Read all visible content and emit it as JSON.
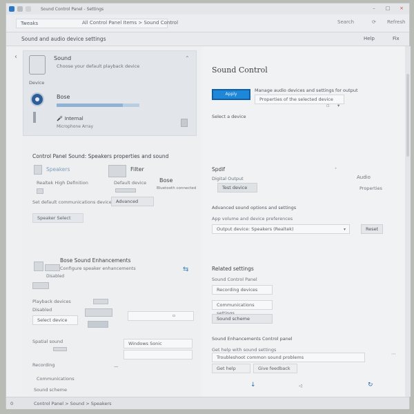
{
  "window": {
    "title": "Sound Control Panel - Settings",
    "colors": {
      "accent": "#1f87d8",
      "accent_border": "#0d5ea6",
      "window_bg": "#eceef0"
    }
  },
  "addressbar": {
    "field_text": "Tweaks",
    "url": "All Control Panel Items > Sound Control",
    "right_a": "Search",
    "right_b": "Refresh"
  },
  "breadcrumb": {
    "text": "Sound and audio device settings",
    "right_a": "Help",
    "right_b": "Fix"
  },
  "left": {
    "card": {
      "title": "Sound",
      "subtitle": "Choose your default playback device",
      "label2": "Device",
      "device_label": "Bose",
      "device_level": 0.8,
      "mic_label": "Internal",
      "mic_sub": "Microphone Array"
    },
    "section1": {
      "heading": "Control Panel Sound: Speakers properties and sound",
      "item1_title": "Speakers",
      "item1_sub": "Realtek High Definition",
      "item2_title": "Filter",
      "item2_sub": "Default device",
      "item3_title": "Bose",
      "item3_sub": "Bluetooth connected",
      "row_text": "Set default communications device",
      "row_btn": "Advanced",
      "tag_text": "Speaker Select"
    },
    "section2": {
      "heading": "Bose Sound Enhancements",
      "sub": "Configure speaker enhancements",
      "label_a": "Playback devices",
      "input_a": "Select device",
      "label_b": "Disabled",
      "label_c": "Spatial sound",
      "option_a": "Windows Sonic",
      "label_d": "Recording",
      "label_e": "Communications",
      "label_f": "Sound scheme"
    }
  },
  "right": {
    "title": "Sound Control",
    "primary_btn": "Apply",
    "desc_line": "Manage audio devices and settings for output",
    "desc_sub": "Properties of the selected device",
    "link_text": "Select a device",
    "spk_heading": "Spdif",
    "spk_sub": "Digital Output",
    "spk_btn": "Test device",
    "spk_right_a": "Audio",
    "spk_right_b": "Properties",
    "adv_heading": "Advanced sound options and settings",
    "adv_sub": "App volume and device preferences",
    "adv_input": "Output device: Speakers (Realtek)",
    "adv_btn": "Reset",
    "rel_heading": "Related settings",
    "rel_sub": "Sound Control Panel",
    "rel_btn1": "Recording devices",
    "rel_btn2": "Communications settings",
    "rel_btn3": "Sound scheme",
    "bottom_heading": "Sound Enhancements Control panel",
    "bottom_sub": "Get help with sound settings",
    "bottom_input": "Troubleshoot common sound problems",
    "bottom_btn1": "Get help",
    "bottom_btn2": "Give feedback"
  },
  "statusbar": {
    "left": "0",
    "text": "Control Panel > Sound > Speakers"
  }
}
